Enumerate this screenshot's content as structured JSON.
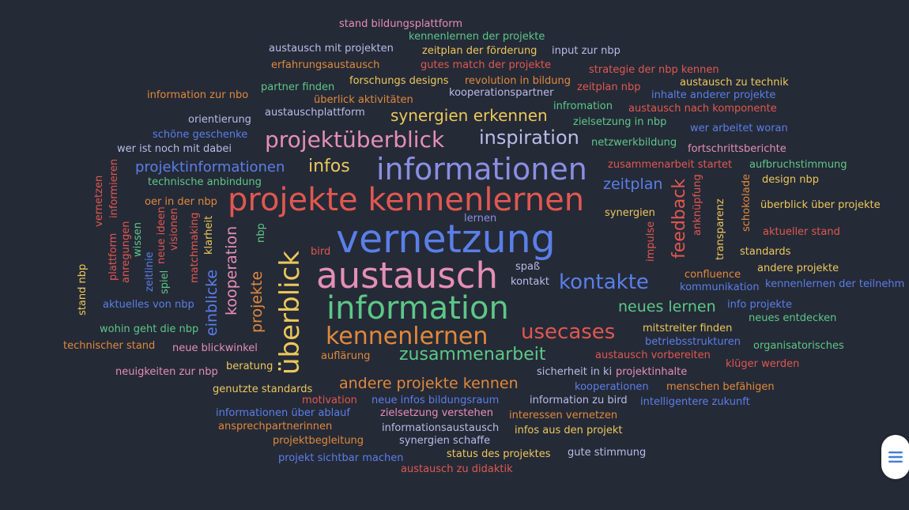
{
  "colors": {
    "bg": "#252a37",
    "red": "#e0584f",
    "blue": "#5a7fe8",
    "green": "#5cc887",
    "yellow": "#ecc85b",
    "orange": "#e0893b",
    "pink": "#e58fb4",
    "lavender": "#b9bde8",
    "purple": "#8a8fe3"
  },
  "menu_icon": "hamburger-menu-icon",
  "words": [
    {
      "text": "stand bildungsplattform",
      "color": "pink"
    },
    {
      "text": "kennenlernen der projekte",
      "color": "green"
    },
    {
      "text": "austausch mit projekten",
      "color": "lavender"
    },
    {
      "text": "zeitplan der förderung",
      "color": "yellow"
    },
    {
      "text": "input zur nbp",
      "color": "lavender"
    },
    {
      "text": "erfahrungsaustausch",
      "color": "orange"
    },
    {
      "text": "gutes match der projekte",
      "color": "red"
    },
    {
      "text": "strategie der nbp kennen",
      "color": "red"
    },
    {
      "text": "forschungs designs",
      "color": "yellow"
    },
    {
      "text": "revolution in bildung",
      "color": "orange"
    },
    {
      "text": "austausch zu technik",
      "color": "yellow"
    },
    {
      "text": "partner finden",
      "color": "green"
    },
    {
      "text": "zeitplan nbp",
      "color": "red"
    },
    {
      "text": "kooperationspartner",
      "color": "lavender"
    },
    {
      "text": "inhalte anderer projekte",
      "color": "blue"
    },
    {
      "text": "information zur nbo",
      "color": "orange"
    },
    {
      "text": "überlick aktivitäten",
      "color": "orange"
    },
    {
      "text": "infromation",
      "color": "green"
    },
    {
      "text": "austausch nach komponente",
      "color": "red"
    },
    {
      "text": "austauschplattform",
      "color": "lavender"
    },
    {
      "text": "synergien erkennen",
      "color": "yellow"
    },
    {
      "text": "orientierung",
      "color": "lavender"
    },
    {
      "text": "zielsetzung in nbp",
      "color": "green"
    },
    {
      "text": "wer arbeitet woran",
      "color": "blue"
    },
    {
      "text": "schöne geschenke",
      "color": "blue"
    },
    {
      "text": "projektüberblick",
      "color": "pink"
    },
    {
      "text": "inspiration",
      "color": "lavender"
    },
    {
      "text": "netzwerkbildung",
      "color": "green"
    },
    {
      "text": "wer ist noch mit dabei",
      "color": "lavender"
    },
    {
      "text": "fortschrittsberichte",
      "color": "pink"
    },
    {
      "text": "projektinformationen",
      "color": "blue"
    },
    {
      "text": "infos",
      "color": "yellow"
    },
    {
      "text": "informationen",
      "color": "purple"
    },
    {
      "text": "zusammenarbeit startet",
      "color": "red"
    },
    {
      "text": "aufbruchstimmung",
      "color": "green"
    },
    {
      "text": "technische anbindung",
      "color": "green"
    },
    {
      "text": "zeitplan",
      "color": "blue"
    },
    {
      "text": "design nbp",
      "color": "yellow"
    },
    {
      "text": "projekte kennenlernen",
      "color": "red"
    },
    {
      "text": "oer in der nbp",
      "color": "orange"
    },
    {
      "text": "lernen",
      "color": "purple"
    },
    {
      "text": "synergien",
      "color": "yellow"
    },
    {
      "text": "überblick über projekte",
      "color": "yellow"
    },
    {
      "text": "vernetzung",
      "color": "blue"
    },
    {
      "text": "aktueller stand",
      "color": "red"
    },
    {
      "text": "bird",
      "color": "red"
    },
    {
      "text": "standards",
      "color": "yellow"
    },
    {
      "text": "austausch",
      "color": "pink"
    },
    {
      "text": "spaß",
      "color": "lavender"
    },
    {
      "text": "confluence",
      "color": "orange"
    },
    {
      "text": "andere projekte",
      "color": "yellow"
    },
    {
      "text": "kontakt",
      "color": "lavender"
    },
    {
      "text": "kontakte",
      "color": "blue"
    },
    {
      "text": "kommunikation",
      "color": "blue"
    },
    {
      "text": "kennenlernen der teilnehm",
      "color": "blue"
    },
    {
      "text": "aktuelles von nbp",
      "color": "blue"
    },
    {
      "text": "information",
      "color": "green"
    },
    {
      "text": "neues lernen",
      "color": "green"
    },
    {
      "text": "info projekte",
      "color": "blue"
    },
    {
      "text": "neues entdecken",
      "color": "green"
    },
    {
      "text": "wohin geht die nbp",
      "color": "green"
    },
    {
      "text": "kennenlernen",
      "color": "orange"
    },
    {
      "text": "usecases",
      "color": "red"
    },
    {
      "text": "mitstreiter finden",
      "color": "yellow"
    },
    {
      "text": "technischer stand",
      "color": "orange"
    },
    {
      "text": "neue blickwinkel",
      "color": "pink"
    },
    {
      "text": "betriebsstrukturen",
      "color": "blue"
    },
    {
      "text": "organisatorisches",
      "color": "green"
    },
    {
      "text": "auflärung",
      "color": "orange"
    },
    {
      "text": "zusammenarbeit",
      "color": "green"
    },
    {
      "text": "austausch vorbereiten",
      "color": "red"
    },
    {
      "text": "beratung",
      "color": "yellow"
    },
    {
      "text": "klüger werden",
      "color": "red"
    },
    {
      "text": "neuigkeiten zur nbp",
      "color": "pink"
    },
    {
      "text": "sicherheit in ki",
      "color": "lavender"
    },
    {
      "text": "projektinhalte",
      "color": "pink"
    },
    {
      "text": "andere projekte kennen",
      "color": "orange"
    },
    {
      "text": "genutzte standards",
      "color": "yellow"
    },
    {
      "text": "kooperationen",
      "color": "blue"
    },
    {
      "text": "menschen befähigen",
      "color": "orange"
    },
    {
      "text": "motivation",
      "color": "red"
    },
    {
      "text": "neue infos bildungsraum",
      "color": "blue"
    },
    {
      "text": "information zu bird",
      "color": "lavender"
    },
    {
      "text": "intelligentere zukunft",
      "color": "blue"
    },
    {
      "text": "informationen über ablauf",
      "color": "blue"
    },
    {
      "text": "zielsetzung verstehen",
      "color": "pink"
    },
    {
      "text": "interessen vernetzen",
      "color": "orange"
    },
    {
      "text": "ansprechpartnerinnen",
      "color": "orange"
    },
    {
      "text": "informationsaustausch",
      "color": "lavender"
    },
    {
      "text": "infos aus den projekt",
      "color": "yellow"
    },
    {
      "text": "projektbegleitung",
      "color": "orange"
    },
    {
      "text": "synergien schaffe",
      "color": "lavender"
    },
    {
      "text": "gute stimmung",
      "color": "lavender"
    },
    {
      "text": "status des projektes",
      "color": "yellow"
    },
    {
      "text": "projekt sichtbar machen",
      "color": "blue"
    },
    {
      "text": "austausch zu didaktik",
      "color": "red"
    },
    {
      "text": "vernetzen",
      "color": "red"
    },
    {
      "text": "informieren",
      "color": "red"
    },
    {
      "text": "anregungen",
      "color": "red"
    },
    {
      "text": "plattform",
      "color": "red"
    },
    {
      "text": "wissen",
      "color": "green"
    },
    {
      "text": "neue ideen",
      "color": "red"
    },
    {
      "text": "visionen",
      "color": "red"
    },
    {
      "text": "zeitlinie",
      "color": "blue"
    },
    {
      "text": "spiel",
      "color": "green"
    },
    {
      "text": "matchmaking",
      "color": "red"
    },
    {
      "text": "klarheit",
      "color": "yellow"
    },
    {
      "text": "stand nbp",
      "color": "yellow"
    },
    {
      "text": "einblicke",
      "color": "blue"
    },
    {
      "text": "kooperation",
      "color": "pink"
    },
    {
      "text": "projekte",
      "color": "orange"
    },
    {
      "text": "nbp",
      "color": "green"
    },
    {
      "text": "überblick",
      "color": "yellow"
    },
    {
      "text": "impulse",
      "color": "red"
    },
    {
      "text": "feedback",
      "color": "red"
    },
    {
      "text": "anknüpfung",
      "color": "red"
    },
    {
      "text": "transparenz",
      "color": "yellow"
    },
    {
      "text": "schokolade",
      "color": "orange"
    }
  ]
}
